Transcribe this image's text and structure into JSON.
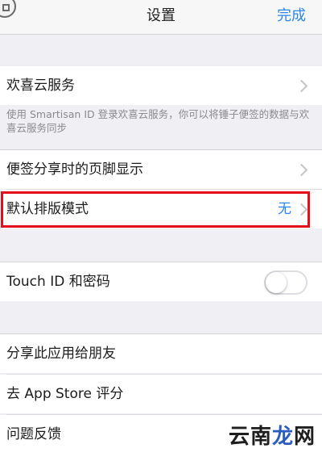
{
  "nav": {
    "title": "设置",
    "done_label": "完成"
  },
  "cloud": {
    "label": "欢喜云服务",
    "description": "使用 Smartisan ID 登录欢喜云服务，你可以将锤子便签的数据与欢喜云服务同步"
  },
  "footer_display": {
    "label": "便签分享时的页脚显示"
  },
  "default_layout": {
    "label": "默认排版模式",
    "value": "无"
  },
  "touch_id": {
    "label": "Touch ID 和密码",
    "enabled": false
  },
  "share_app": {
    "label": "分享此应用给朋友"
  },
  "app_store": {
    "label": "去 App Store 评分"
  },
  "feedback": {
    "label": "问题反馈"
  },
  "watermark": {
    "part1": "云南",
    "part2": "龙",
    "part3": "网"
  },
  "colors": {
    "accent": "#2e87e8",
    "highlight": "#e3101b",
    "background": "#efeff4"
  },
  "icons": {
    "back": "back-icon",
    "chevron": "chevron-right-icon"
  }
}
